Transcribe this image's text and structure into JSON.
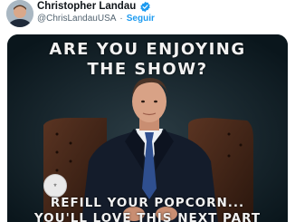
{
  "tweet": {
    "author_name": "Christopher Landau",
    "handle": "@ChrisLandauUSA",
    "separator": "·",
    "follow_label": "Seguir"
  },
  "media": {
    "caption_line1": "ARE YOU ENJOYING",
    "caption_line2": "THE SHOW?",
    "caption_line3": "REFILL YOUR POPCORN...",
    "caption_line4": "YOU'LL LOVE THIS NEXT PART"
  },
  "colors": {
    "verified": "#1d9bf0",
    "follow": "#1d9bf0",
    "name": "#0f1419",
    "handle": "#536471"
  }
}
